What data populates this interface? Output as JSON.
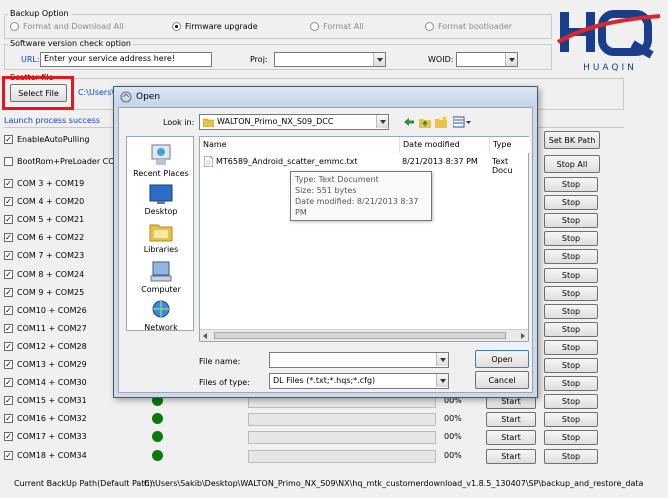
{
  "backup_option": {
    "title": "Backup Option",
    "options": [
      {
        "label": "Format and Download All",
        "selected": false,
        "enabled": false
      },
      {
        "label": "Firmware upgrade",
        "selected": true,
        "enabled": true
      },
      {
        "label": "Format All",
        "selected": false,
        "enabled": false
      },
      {
        "label": "Format bootloader",
        "selected": false,
        "enabled": false
      }
    ]
  },
  "version_check": {
    "title": "Software version check option",
    "url_label": "URL:",
    "url_value": "Enter your service address here!",
    "proj_label": "Proj:",
    "proj_value": "",
    "woid_label": "WOID:",
    "woid_value": ""
  },
  "scatter": {
    "title": "Scatter file",
    "select_button": "Select File",
    "path": "C:\\Users\\S"
  },
  "logo": {
    "text": "HUAQIN",
    "color_red": "#d8272d",
    "color_blue": "#1a3e8c"
  },
  "status_text": "Launch process success",
  "options": {
    "enable_auto_polling": "EnableAutoPulling",
    "bootrom_preloader": "BootRom+PreLoader COM S"
  },
  "buttons": {
    "set_bk_path": "Set BK Path",
    "stop_all": "Stop All",
    "start": "Start",
    "stop": "Stop"
  },
  "com_rows": [
    {
      "label": "COM 3 + COM19",
      "percent": ""
    },
    {
      "label": "COM 4 + COM20",
      "percent": ""
    },
    {
      "label": "COM 5 + COM21",
      "percent": ""
    },
    {
      "label": "COM 6 + COM22",
      "percent": ""
    },
    {
      "label": "COM 7 + COM23",
      "percent": ""
    },
    {
      "label": "COM 8 + COM24",
      "percent": ""
    },
    {
      "label": "COM 9 + COM25",
      "percent": ""
    },
    {
      "label": "COM10 + COM26",
      "percent": ""
    },
    {
      "label": "COM11 + COM27",
      "percent": ""
    },
    {
      "label": "COM12 + COM28",
      "percent": ""
    },
    {
      "label": "COM13 + COM29",
      "percent": ""
    },
    {
      "label": "COM14 + COM30",
      "percent": ""
    },
    {
      "label": "COM15 + COM31",
      "percent": "00%"
    },
    {
      "label": "COM16 + COM32",
      "percent": "00%"
    },
    {
      "label": "COM17 + COM33",
      "percent": "00%"
    },
    {
      "label": "COM18 + COM34",
      "percent": "00%"
    }
  ],
  "footer": {
    "label": "Current BackUp Path(Default Path):",
    "path": "C:\\Users\\Sakib\\Desktop\\WALTON_Primo_NX_S09\\NX\\hq_mtk_customerdownload_v1.8.5_130407\\SP\\backup_and_restore_data"
  },
  "dialog": {
    "title": "Open",
    "look_in_label": "Look in:",
    "look_in_value": "WALTON_Primo_NX_S09_DCC",
    "places": [
      "Recent Places",
      "Desktop",
      "Libraries",
      "Computer",
      "Network"
    ],
    "columns": [
      "Name",
      "Date modified",
      "Type"
    ],
    "files": [
      {
        "name": "MT6589_Android_scatter_emmc.txt",
        "date": "8/21/2013 8:37 PM",
        "type": "Text Docu"
      }
    ],
    "tooltip": {
      "line1": "Type: Text Document",
      "line2": "Size: 551 bytes",
      "line3": "Date modified: 8/21/2013 8:37 PM"
    },
    "file_name_label": "File name:",
    "file_name_value": "",
    "files_of_type_label": "Files of type:",
    "files_of_type_value": "DL Files (*.txt;*.hqs;*.cfg)",
    "open_button": "Open",
    "cancel_button": "Cancel"
  }
}
